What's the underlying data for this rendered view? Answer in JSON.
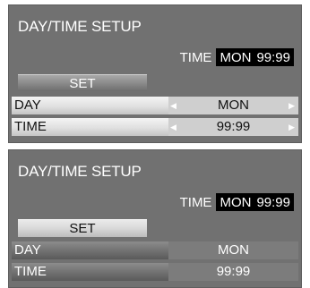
{
  "panels": [
    {
      "title": "DAY/TIME SETUP",
      "time_label": "TIME",
      "time_day": "MON",
      "time_clock": "99:99",
      "set_label": "SET",
      "rows": [
        {
          "label": "DAY",
          "value": "MON"
        },
        {
          "label": "TIME",
          "value": "99:99"
        }
      ],
      "arrows": {
        "left": "◀",
        "right": "▶"
      }
    },
    {
      "title": "DAY/TIME SETUP",
      "time_label": "TIME",
      "time_day": "MON",
      "time_clock": "99:99",
      "set_label": "SET",
      "rows": [
        {
          "label": "DAY",
          "value": "MON"
        },
        {
          "label": "TIME",
          "value": "99:99"
        }
      ]
    }
  ],
  "colors": {
    "panel_bg": "#717171",
    "highlight_row": "#cfcfcf",
    "time_value_bg": "#000000"
  }
}
